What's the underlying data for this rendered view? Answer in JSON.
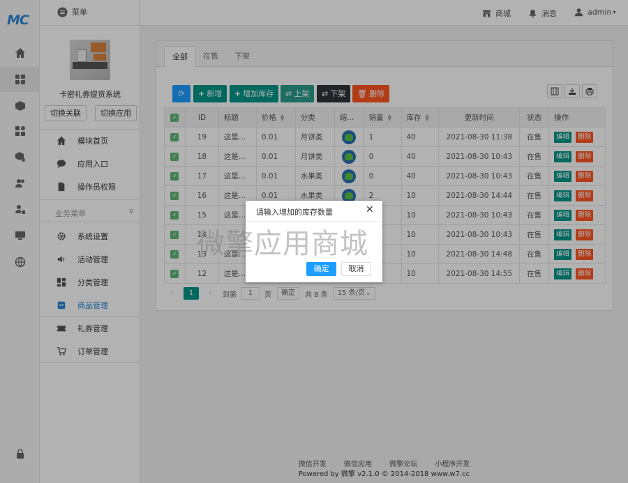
{
  "logo": "MC",
  "topbar": {
    "menu_label": "菜单",
    "shop": "商城",
    "messages": "消息",
    "user": "admin"
  },
  "sidebar": {
    "app_name": "卡密礼券提货系统",
    "switch_link": "切换关联",
    "switch_app": "切换应用",
    "items": [
      {
        "label": "模块首页",
        "icon": "home-icon"
      },
      {
        "label": "应用入口",
        "icon": "chat-icon"
      },
      {
        "label": "操作员权限",
        "icon": "document-icon"
      }
    ],
    "group_title": "业务菜单",
    "business": [
      {
        "label": "系统设置",
        "icon": "gear-icon"
      },
      {
        "label": "活动管理",
        "icon": "speaker-icon"
      },
      {
        "label": "分类管理",
        "icon": "grid-icon"
      },
      {
        "label": "商品管理",
        "icon": "bag-icon"
      },
      {
        "label": "礼券管理",
        "icon": "ticket-icon"
      },
      {
        "label": "订单管理",
        "icon": "cart-icon"
      }
    ]
  },
  "tabs": [
    "全部",
    "在售",
    "下架"
  ],
  "toolbar": {
    "refresh": "",
    "add": "新增",
    "add_stock": "增加库存",
    "on_shelf": "上架",
    "off_shelf": "下架",
    "delete": "删除"
  },
  "table": {
    "headers": [
      "ID",
      "标题",
      "价格",
      "分类",
      "缩...",
      "销量",
      "库存",
      "更新时间",
      "状态",
      "操作"
    ],
    "rows": [
      {
        "id": "19",
        "title": "这是...",
        "price": "0.01",
        "category": "月饼类",
        "sales": "1",
        "stock": "40",
        "updated": "2021-08-30 11:38",
        "status": "在售"
      },
      {
        "id": "18",
        "title": "这是...",
        "price": "0.01",
        "category": "月饼类",
        "sales": "0",
        "stock": "40",
        "updated": "2021-08-30 10:43",
        "status": "在售"
      },
      {
        "id": "17",
        "title": "这是...",
        "price": "0.01",
        "category": "水果类",
        "sales": "0",
        "stock": "40",
        "updated": "2021-08-30 10:43",
        "status": "在售"
      },
      {
        "id": "16",
        "title": "这是...",
        "price": "0.01",
        "category": "水果类",
        "sales": "2",
        "stock": "10",
        "updated": "2021-08-30 14:44",
        "status": "在售"
      },
      {
        "id": "15",
        "title": "这是...",
        "price": "",
        "category": "",
        "sales": "",
        "stock": "10",
        "updated": "2021-08-30 10:43",
        "status": "在售"
      },
      {
        "id": "14",
        "title": "",
        "price": "",
        "category": "",
        "sales": "",
        "stock": "10",
        "updated": "2021-08-30 10:43",
        "status": "在售"
      },
      {
        "id": "13",
        "title": "这是...",
        "price": "",
        "category": "",
        "sales": "",
        "stock": "10",
        "updated": "2021-08-30 14:48",
        "status": "在售"
      },
      {
        "id": "12",
        "title": "这是...",
        "price": "",
        "category": "",
        "sales": "",
        "stock": "10",
        "updated": "2021-08-30 14:55",
        "status": "在售"
      }
    ],
    "edit_label": "编辑",
    "delete_label": "删除"
  },
  "pager": {
    "current": "1",
    "goto_prefix": "到第",
    "goto_value": "1",
    "goto_suffix": "页",
    "confirm": "确定",
    "total": "共 8 条",
    "page_size": "15 条/页"
  },
  "modal": {
    "title": "请输入增加的库存数量",
    "ok": "确定",
    "cancel": "取消",
    "watermark": "微擎应用商城"
  },
  "footer": {
    "links": [
      "微信开发",
      "微信应用",
      "微擎论坛",
      "小程序开发"
    ],
    "copyright": "Powered by 微擎 v2.1.0 © 2014-2018 www.w7.cc"
  }
}
